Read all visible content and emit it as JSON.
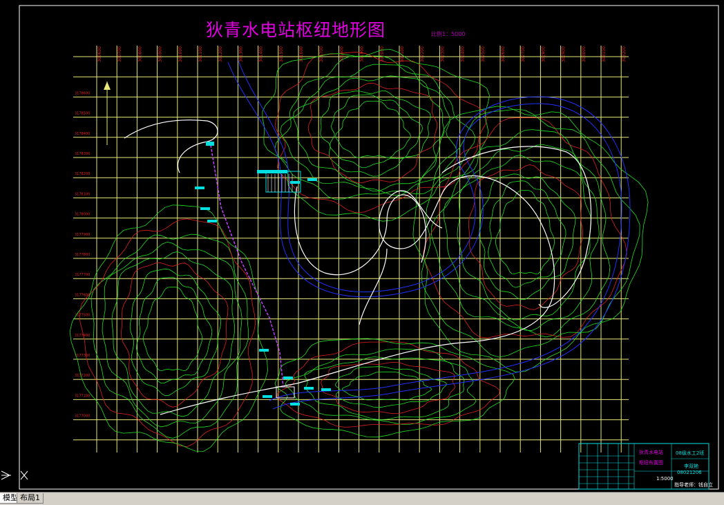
{
  "drawing": {
    "title": "狄青水电站枢纽地形图",
    "scale_note": "比例1：5000"
  },
  "grid": {
    "top_labels": [
      "300600",
      "300700",
      "300800",
      "300900",
      "301000",
      "301100",
      "301200",
      "301300",
      "301400",
      "301500",
      "301600",
      "301700",
      "301800",
      "301900",
      "302000",
      "302100",
      "302200",
      "302300",
      "302400",
      "302500",
      "302600",
      "302700",
      "302800",
      "302900",
      "303000",
      "303100",
      "303200"
    ],
    "left_labels": [
      "3178600",
      "3178500",
      "3178400",
      "3178300",
      "3178200",
      "3178100",
      "3178000",
      "3177900",
      "3177800",
      "3177700",
      "3177600",
      "3177500",
      "3177400",
      "3177300",
      "3177200",
      "3177100",
      "3177000"
    ]
  },
  "title_block": {
    "name_line1": "狄青水电站",
    "name_line2": "枢纽布置图",
    "class_info": "08级水工2班",
    "student": "李双艳",
    "student_id": "08021206",
    "scale": "1:5000",
    "advisor": "指导老师：钱自立"
  },
  "colors": {
    "grid": "#e8e87a",
    "contour_green": "#22e022",
    "contour_red": "#e02020",
    "contour_blue": "#2030ff",
    "road": "#ffffff",
    "title": "#e000e0",
    "structure": "#00e0e0"
  },
  "tabs": {
    "model": "模型",
    "layout1": "布局1"
  }
}
